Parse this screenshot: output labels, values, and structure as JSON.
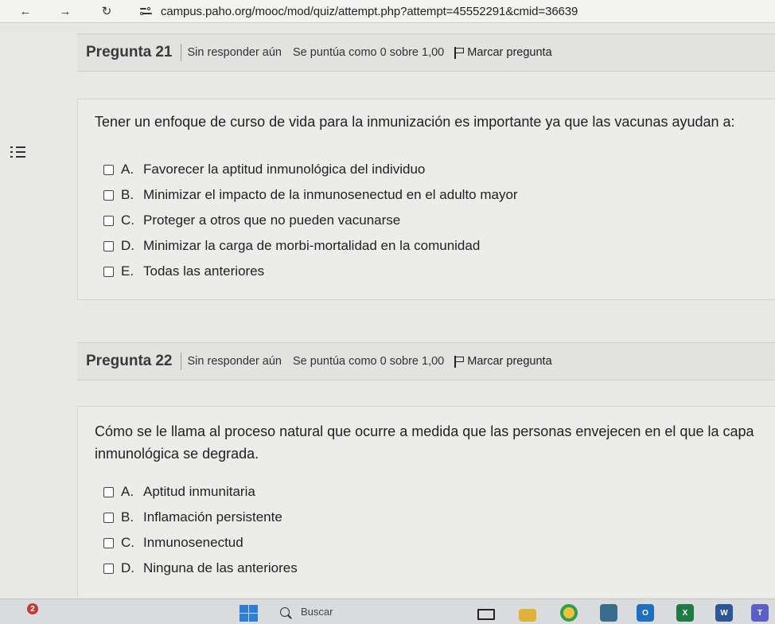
{
  "browser": {
    "url": "campus.paho.org/mooc/mod/quiz/attempt.php?attempt=45552291&cmid=36639"
  },
  "questions": [
    {
      "label": "Pregunta",
      "number": "21",
      "state": "Sin responder aún",
      "grade": "Se puntúa como 0 sobre 1,00",
      "flag_label": "Marcar pregunta",
      "text": "Tener un enfoque de curso de vida para la inmunización es importante ya que las vacunas ayudan a:",
      "options": [
        {
          "letter": "A.",
          "text": "Favorecer la aptitud inmunológica del individuo",
          "checked": false
        },
        {
          "letter": "B.",
          "text": "Minimizar el impacto de la inmunosenectud en el adulto mayor",
          "checked": false
        },
        {
          "letter": "C.",
          "text": "Proteger a otros que no pueden vacunarse",
          "checked": false
        },
        {
          "letter": "D.",
          "text": "Minimizar la carga de morbi-mortalidad en la comunidad",
          "checked": false
        },
        {
          "letter": "E.",
          "text": "Todas las anteriores",
          "checked": false
        }
      ]
    },
    {
      "label": "Pregunta",
      "number": "22",
      "state": "Sin responder aún",
      "grade": "Se puntúa como 0 sobre 1,00",
      "flag_label": "Marcar pregunta",
      "text_lines": [
        "Cómo se le llama al proceso natural que ocurre a medida que las personas envejecen en el que la capa",
        "inmunológica se degrada."
      ],
      "options": [
        {
          "letter": "A.",
          "text": "Aptitud inmunitaria",
          "checked": false
        },
        {
          "letter": "B.",
          "text": "Inflamación persistente",
          "checked": false
        },
        {
          "letter": "C.",
          "text": "Inmunosenectud",
          "checked": false
        },
        {
          "letter": "D.",
          "text": "Ninguna de las anteriores",
          "checked": false
        }
      ]
    }
  ],
  "taskbar": {
    "notification_count": "2",
    "search_placeholder": "Buscar",
    "apps": [
      "task-view",
      "file-explorer",
      "chrome",
      "store",
      "outlook",
      "excel",
      "word",
      "teams"
    ]
  }
}
